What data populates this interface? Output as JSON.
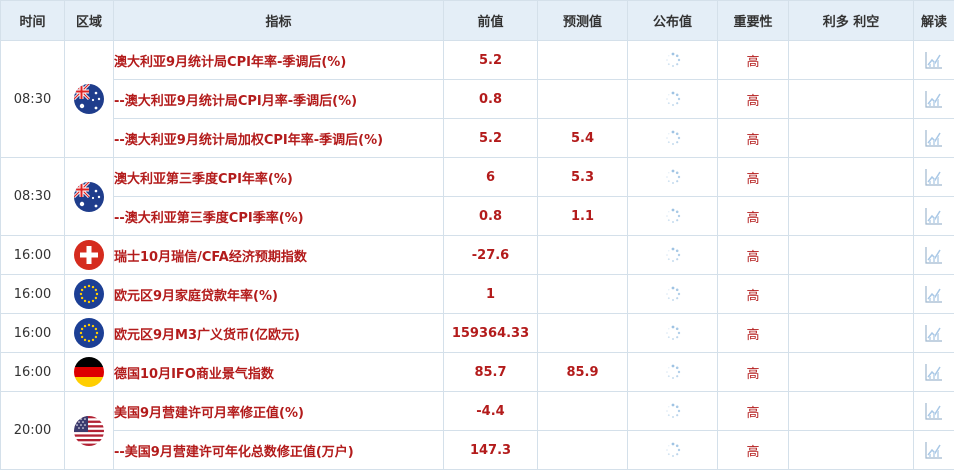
{
  "headers": {
    "time": "时间",
    "region": "区域",
    "indicator": "指标",
    "previous": "前值",
    "forecast": "预测值",
    "actual": "公布值",
    "importance": "重要性",
    "impact": "利多 利空",
    "analysis": "解读"
  },
  "groups": [
    {
      "time": "08:30",
      "flag": "australia-flag-icon",
      "rows": [
        {
          "indicator": "澳大利亚9月统计局CPI年率-季调后(%)",
          "previous": "5.2",
          "forecast": "",
          "importance": "高"
        },
        {
          "indicator": "--澳大利亚9月统计局CPI月率-季调后(%)",
          "previous": "0.8",
          "forecast": "",
          "importance": "高"
        },
        {
          "indicator": "--澳大利亚9月统计局加权CPI年率-季调后(%)",
          "previous": "5.2",
          "forecast": "5.4",
          "importance": "高"
        }
      ]
    },
    {
      "time": "08:30",
      "flag": "australia-flag-icon",
      "rows": [
        {
          "indicator": "澳大利亚第三季度CPI年率(%)",
          "previous": "6",
          "forecast": "5.3",
          "importance": "高"
        },
        {
          "indicator": "--澳大利亚第三季度CPI季率(%)",
          "previous": "0.8",
          "forecast": "1.1",
          "importance": "高"
        }
      ]
    },
    {
      "time": "16:00",
      "flag": "switzerland-flag-icon",
      "rows": [
        {
          "indicator": "瑞士10月瑞信/CFA经济预期指数",
          "previous": "-27.6",
          "forecast": "",
          "importance": "高"
        }
      ]
    },
    {
      "time": "16:00",
      "flag": "eu-flag-icon",
      "rows": [
        {
          "indicator": "欧元区9月家庭贷款年率(%)",
          "previous": "1",
          "forecast": "",
          "importance": "高"
        }
      ]
    },
    {
      "time": "16:00",
      "flag": "eu-flag-icon",
      "rows": [
        {
          "indicator": "欧元区9月M3广义货币(亿欧元)",
          "previous": "159364.33",
          "forecast": "",
          "importance": "高"
        }
      ]
    },
    {
      "time": "16:00",
      "flag": "germany-flag-icon",
      "rows": [
        {
          "indicator": "德国10月IFO商业景气指数",
          "previous": "85.7",
          "forecast": "85.9",
          "importance": "高"
        }
      ]
    },
    {
      "time": "20:00",
      "flag": "usa-flag-icon",
      "rows": [
        {
          "indicator": "美国9月营建许可月率修正值(%)",
          "previous": "-4.4",
          "forecast": "",
          "importance": "高"
        },
        {
          "indicator": "--美国9月营建许可年化总数修正值(万户)",
          "previous": "147.3",
          "forecast": "",
          "importance": "高"
        }
      ]
    }
  ],
  "colors": {
    "header_bg": "#e4eef7",
    "border": "#d4e0ea",
    "accent_red": "#b31b1b"
  },
  "icons": {
    "actual_pending": "loading-spinner-icon",
    "analysis": "line-chart-icon"
  }
}
